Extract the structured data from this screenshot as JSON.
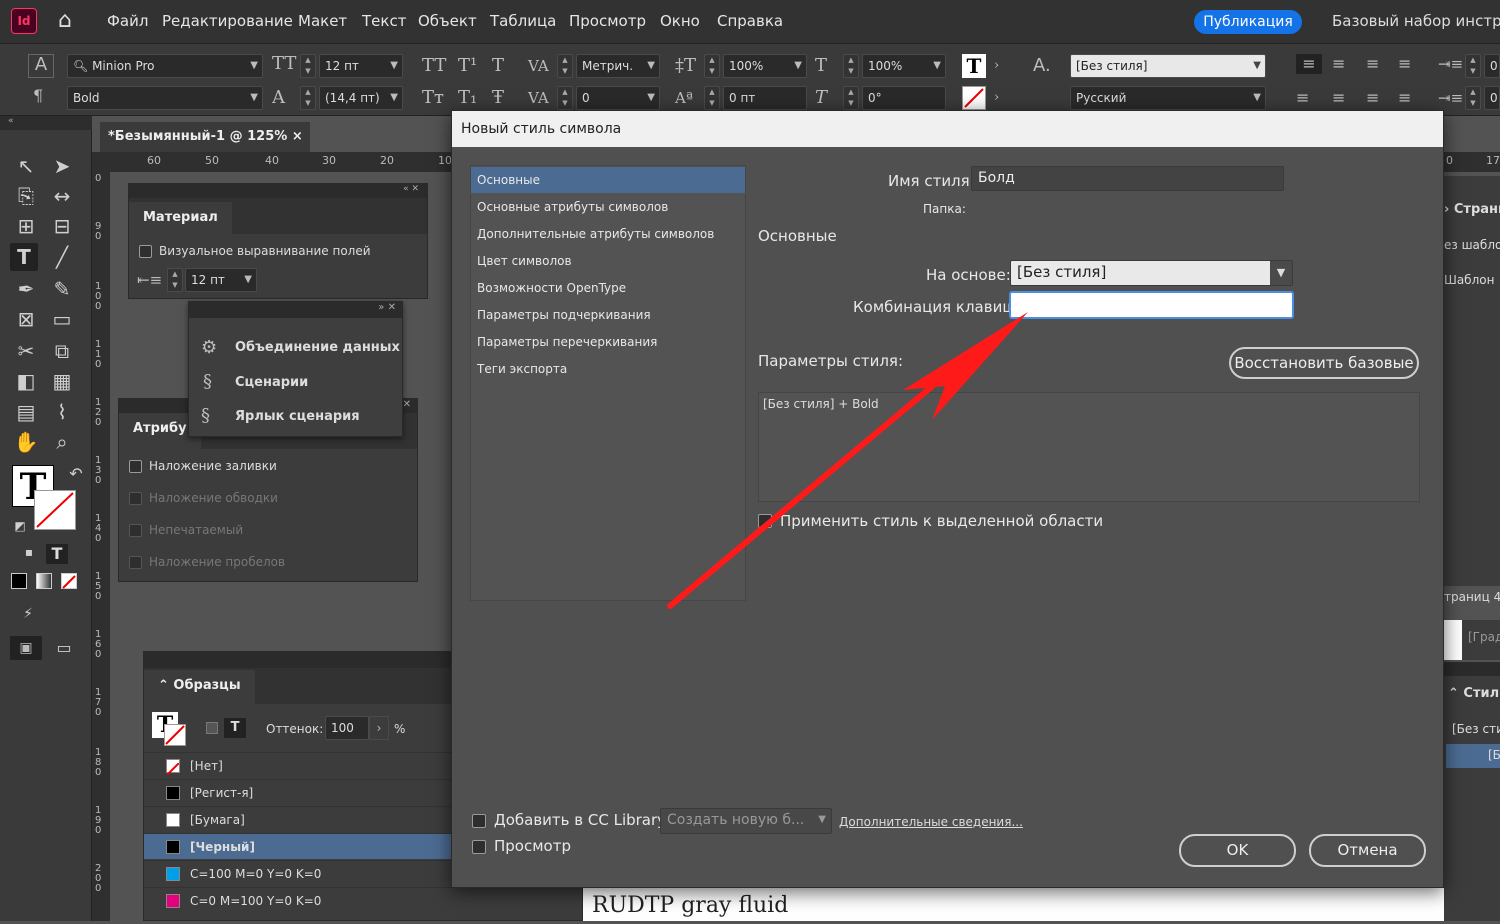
{
  "app": {
    "logo": "Id"
  },
  "menu": {
    "items": [
      "Файл",
      "Редактирование",
      "Макет",
      "Текст",
      "Объект",
      "Таблица",
      "Просмотр",
      "Окно",
      "Справка"
    ],
    "publish": "Публикация",
    "workspace": "Базовый набор инструм"
  },
  "control": {
    "font_family": "Minion Pro",
    "font_style": "Bold",
    "font_size": "12 пт",
    "leading": "(14,4 пт)",
    "kerning": "Метрич.",
    "tracking": "0",
    "vscale": "100%",
    "hscale": "100%",
    "baseline": "0 пт",
    "skew": "0°",
    "char_style": "[Без стиля]",
    "language": "Русский",
    "right_a": "0",
    "right_b": "0"
  },
  "document": {
    "tab_title": "*Безымянный-1 @ 125%",
    "close": "×",
    "ruler_h": [
      "60",
      "50",
      "40",
      "30",
      "20",
      "10"
    ],
    "ruler_v": [
      "0",
      "9\n0",
      "1\n0\n0",
      "1\n1\n0",
      "1\n2\n0",
      "1\n3\n0",
      "1\n4\n0",
      "1\n5\n0",
      "1\n6\n0",
      "1\n7\n0",
      "1\n8\n0",
      "1\n9\n0",
      "2\n0\n0"
    ],
    "page_text": "RUDTP gray fluid"
  },
  "material_panel": {
    "title": "Материал",
    "checkbox": "Визуальное выравнивание полей",
    "size": "12 пт"
  },
  "scripts_panel": {
    "items": [
      "Объединение данных",
      "Сценарии",
      "Ярлык сценария"
    ]
  },
  "attributes_panel": {
    "title": "Атрибу",
    "items": [
      "Наложение заливки",
      "Наложение обводки",
      "Непечатаемый",
      "Наложение пробелов"
    ]
  },
  "swatches_panel": {
    "title": "Образцы",
    "tint_label": "Оттенок:",
    "tint_value": "100",
    "percent": "%",
    "swatches": [
      {
        "name": "[Нет]",
        "color": "none"
      },
      {
        "name": "[Регист-я]",
        "color": "#000000"
      },
      {
        "name": "[Бумага]",
        "color": "#ffffff"
      },
      {
        "name": "[Черный]",
        "color": "#000000"
      },
      {
        "name": "C=100 M=0 Y=0 K=0",
        "color": "#00a0e9"
      },
      {
        "name": "C=0 M=100 Y=0 K=0",
        "color": "#e4007f"
      }
    ]
  },
  "right_panels": {
    "ruler_a": "0",
    "ruler_b": "17",
    "pages_title": "Страни",
    "no_template": "ез шабло",
    "template": "Шаблон",
    "pages_info": "траниц 4,",
    "grad": "[Град",
    "styles_title": "Стил",
    "no_style": "[Без сти",
    "item": "[Б"
  },
  "dialog": {
    "title": "Новый стиль символа",
    "categories": [
      "Основные",
      "Основные атрибуты символов",
      "Дополнительные атрибуты символов",
      "Цвет символов",
      "Возможности OpenType",
      "Параметры подчеркивания",
      "Параметры перечеркивания",
      "Теги экспорта"
    ],
    "style_name_label": "Имя стиля:",
    "style_name_value": "Болд",
    "folder_label": "Папка:",
    "section_title": "Основные",
    "based_on_label": "На основе:",
    "based_on_value": "[Без стиля]",
    "shortcut_label": "Комбинация клавиш:",
    "shortcut_value": "",
    "style_params_label": "Параметры стиля:",
    "reset_button": "Восстановить базовые",
    "style_params_text": "[Без стиля] + Bold",
    "apply_label": "Применить стиль к выделенной области",
    "add_cc_label": "Добавить в CC Library:",
    "cc_select": "Создать новую б...",
    "more_info": "Дополнительные сведения...",
    "preview_label": "Просмотр",
    "ok": "OK",
    "cancel": "Отмена"
  },
  "annotation": {
    "arrow_color": "#ff1a1a"
  }
}
